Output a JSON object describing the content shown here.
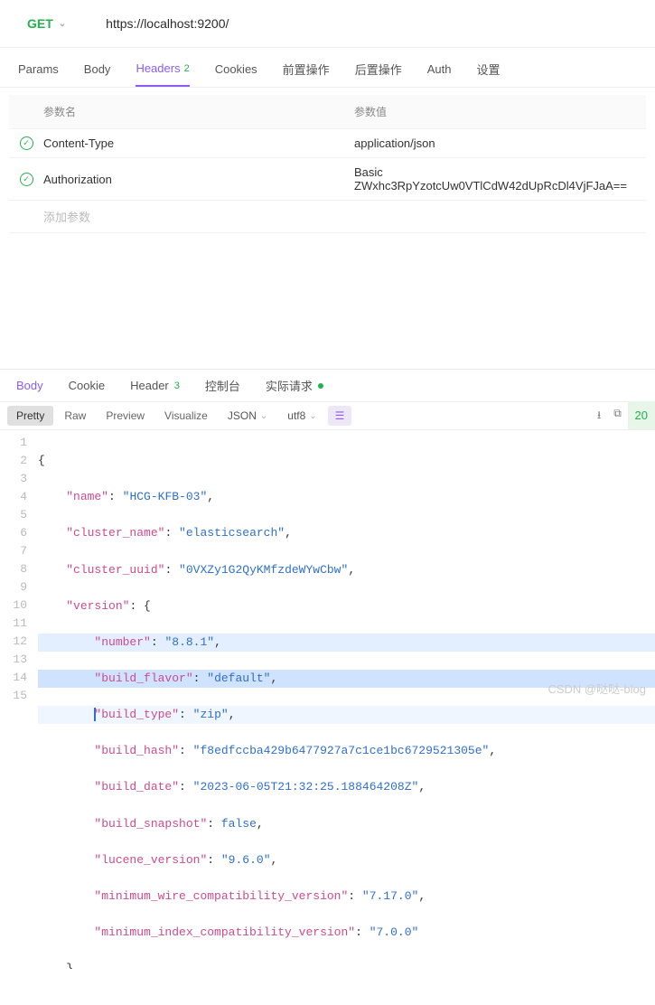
{
  "request": {
    "method": "GET",
    "url": "https://localhost:9200/"
  },
  "req_tabs": {
    "params": "Params",
    "body": "Body",
    "headers": "Headers",
    "headers_count": "2",
    "cookies": "Cookies",
    "pre": "前置操作",
    "post": "后置操作",
    "auth": "Auth",
    "settings": "设置"
  },
  "headers_table": {
    "col_name": "参数名",
    "col_value": "参数值",
    "add": "添加参数",
    "rows": [
      {
        "name": "Content-Type",
        "value": "application/json"
      },
      {
        "name": "Authorization",
        "value": "Basic ZWxhc3RpYzotcUw0VTlCdW42dUpRcDl4VjFJaA=="
      }
    ]
  },
  "res_tabs": {
    "body": "Body",
    "cookie": "Cookie",
    "header": "Header",
    "header_count": "3",
    "console": "控制台",
    "actual": "实际请求"
  },
  "status_partial": "20",
  "toolbar": {
    "pretty": "Pretty",
    "raw": "Raw",
    "preview": "Preview",
    "visualize": "Visualize",
    "format": "JSON",
    "encoding": "utf8"
  },
  "response_body": {
    "name": "HCG-KFB-03",
    "cluster_name": "elasticsearch",
    "cluster_uuid": "0VXZy1G2QyKMfzdeWYwCbw",
    "version": {
      "number": "8.8.1",
      "build_flavor": "default",
      "build_type": "zip",
      "build_hash": "f8edfccba429b6477927a7c1ce1bc6729521305e",
      "build_date": "2023-06-05T21:32:25.188464208Z",
      "build_snapshot": "false",
      "lucene_version": "9.6.0",
      "minimum_wire_compatibility_version": "7.17.0",
      "minimum_index_compatibility_version": "7.0.0"
    }
  },
  "watermark": "CSDN @哒哒-blog"
}
